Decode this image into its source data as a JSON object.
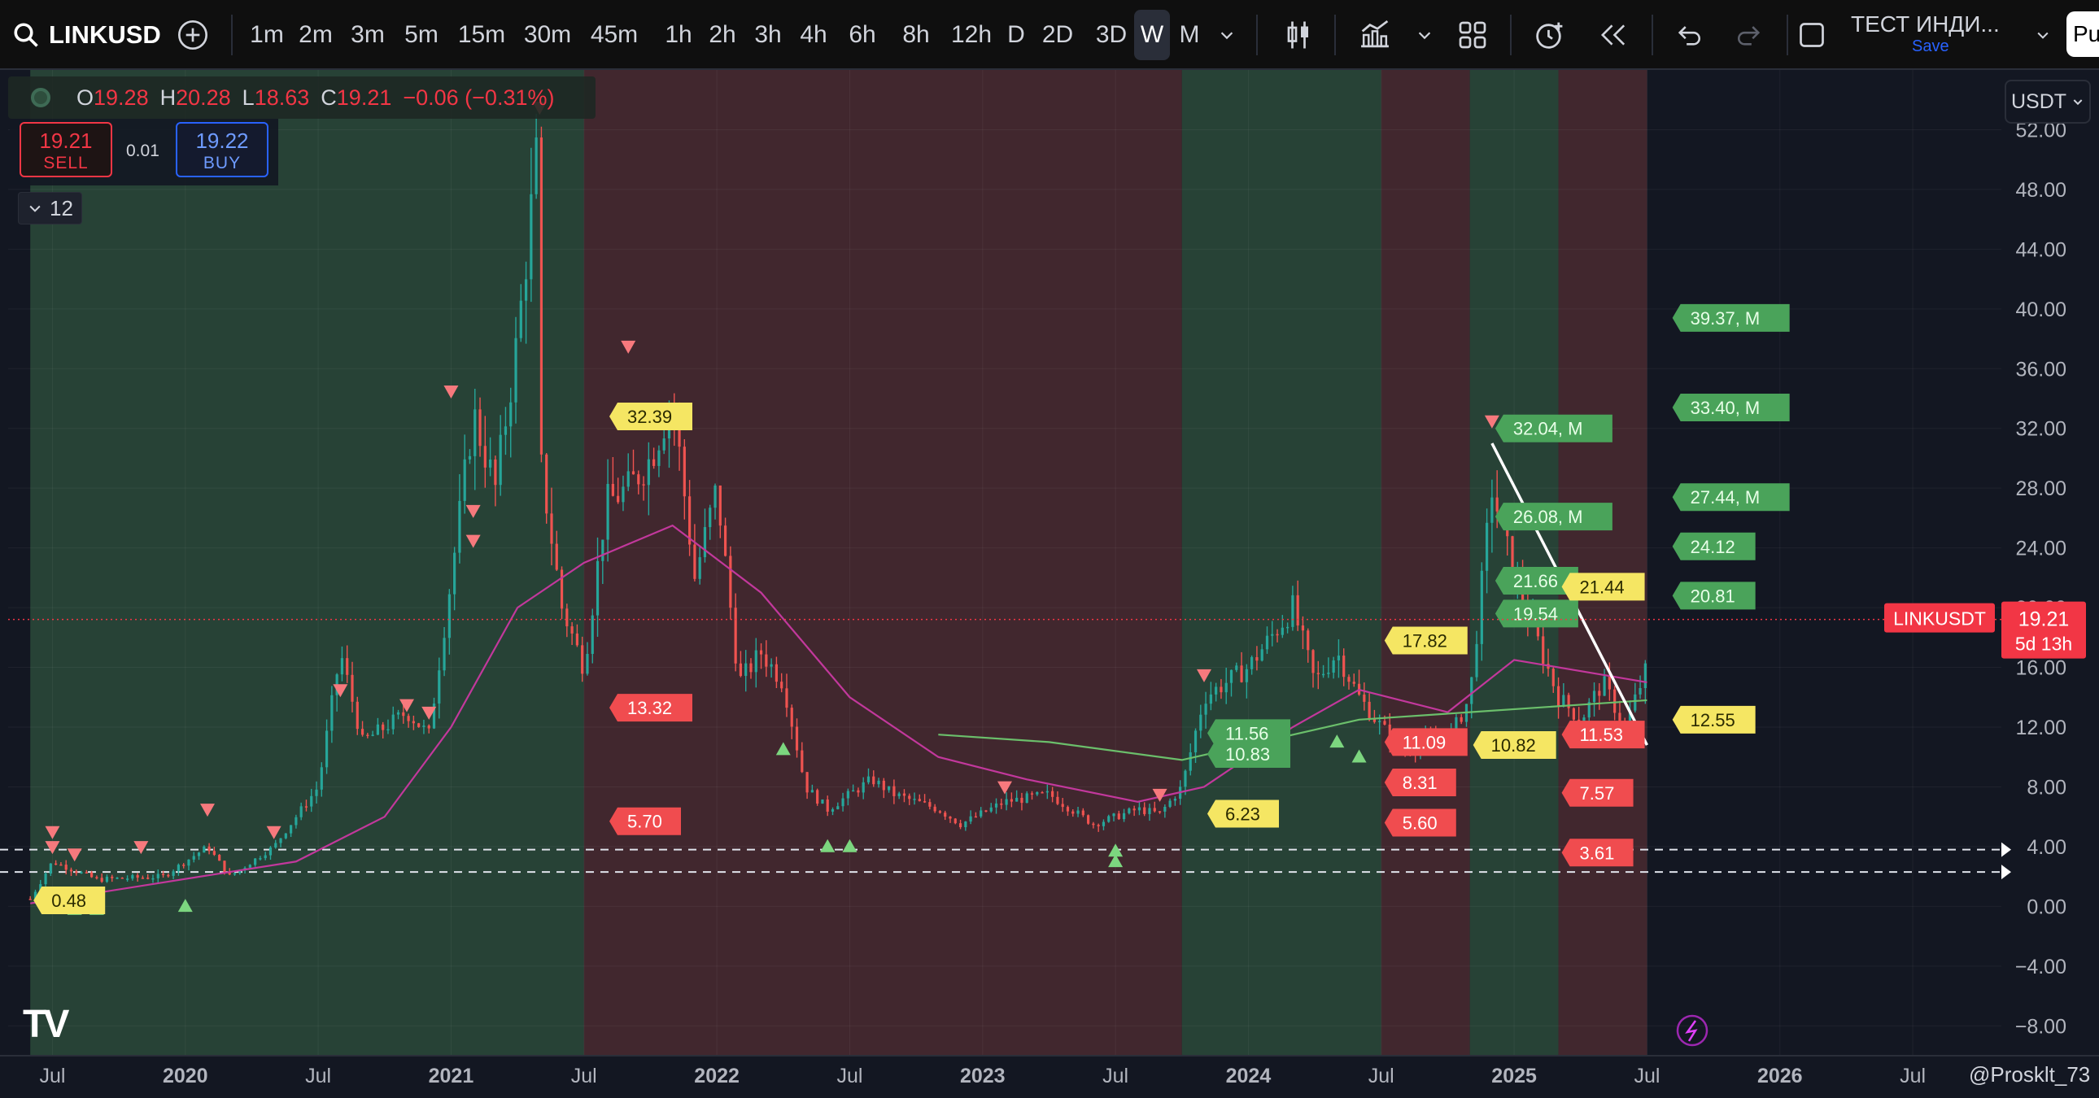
{
  "toolbar": {
    "symbol": "LINKUSD",
    "intervals": [
      "1m",
      "2m",
      "3m",
      "5m",
      "15m",
      "30m",
      "45m",
      "1h",
      "2h",
      "3h",
      "4h",
      "6h",
      "8h",
      "12h",
      "D",
      "2D",
      "3D",
      "W",
      "M"
    ],
    "active_interval": "W",
    "indicator_name": "ТЕСТ ИНДИ...",
    "save_label": "Save",
    "publish_label": "Pu"
  },
  "legend": {
    "o_label": "O",
    "o": "19.28",
    "h_label": "H",
    "h": "20.28",
    "l_label": "L",
    "l": "18.63",
    "c_label": "C",
    "c": "19.21",
    "change": "−0.06 (−0.31%)"
  },
  "trade": {
    "sell_price": "19.21",
    "sell_label": "SELL",
    "spread": "0.01",
    "buy_price": "19.22",
    "buy_label": "BUY"
  },
  "indicators_count": "12",
  "currency": "USDT",
  "price_axis": {
    "labels": [
      "52.00",
      "48.00",
      "44.00",
      "40.00",
      "36.00",
      "32.00",
      "28.00",
      "24.00",
      "20.00",
      "16.00",
      "12.00",
      "8.00",
      "4.00",
      "0.00",
      "−4.00",
      "−8.00"
    ]
  },
  "time_axis": {
    "labels": [
      {
        "text": "Jul",
        "bold": false
      },
      {
        "text": "2020",
        "bold": true
      },
      {
        "text": "Jul",
        "bold": false
      },
      {
        "text": "2021",
        "bold": true
      },
      {
        "text": "Jul",
        "bold": false
      },
      {
        "text": "2022",
        "bold": true
      },
      {
        "text": "Jul",
        "bold": false
      },
      {
        "text": "2023",
        "bold": true
      },
      {
        "text": "Jul",
        "bold": false
      },
      {
        "text": "2024",
        "bold": true
      },
      {
        "text": "Jul",
        "bold": false
      },
      {
        "text": "2025",
        "bold": true
      },
      {
        "text": "Jul",
        "bold": false
      },
      {
        "text": "2026",
        "bold": true
      },
      {
        "text": "Jul",
        "bold": false
      }
    ]
  },
  "chart_data": {
    "type": "candlestick",
    "symbol": "LINKUSDT",
    "interval": "W",
    "ylim": [
      -10,
      56
    ],
    "last_price": "19.21",
    "countdown": "5d 13h",
    "bands": [
      {
        "from": "2019-06",
        "to": "2021-07",
        "color": "#2c4a3a"
      },
      {
        "from": "2021-07",
        "to": "2023-10",
        "color": "#4a2a30"
      },
      {
        "from": "2023-10",
        "to": "2024-07",
        "color": "#2c4a3a"
      },
      {
        "from": "2024-07",
        "to": "2024-11",
        "color": "#4a2a30"
      },
      {
        "from": "2024-11",
        "to": "2025-03",
        "color": "#2c4a3a"
      },
      {
        "from": "2025-03",
        "to": "2025-07",
        "color": "#4a2a30"
      }
    ],
    "price_path": [
      [
        "2019-06",
        0.5
      ],
      [
        "2019-07",
        3.0
      ],
      [
        "2019-09",
        1.8
      ],
      [
        "2019-12",
        2.0
      ],
      [
        "2020-02",
        4.0
      ],
      [
        "2020-03",
        2.0
      ],
      [
        "2020-05",
        4.0
      ],
      [
        "2020-07",
        8.0
      ],
      [
        "2020-08",
        17.0
      ],
      [
        "2020-09",
        11.0
      ],
      [
        "2020-11",
        13.0
      ],
      [
        "2020-12",
        11.5
      ],
      [
        "2021-01",
        22.0
      ],
      [
        "2021-02",
        33.0
      ],
      [
        "2021-03",
        28.0
      ],
      [
        "2021-04",
        38.0
      ],
      [
        "2021-05",
        52.0
      ],
      [
        "2021-05",
        30.0
      ],
      [
        "2021-06",
        20.0
      ],
      [
        "2021-07",
        16.0
      ],
      [
        "2021-08",
        27.0
      ],
      [
        "2021-09",
        28.0
      ],
      [
        "2021-10",
        30.0
      ],
      [
        "2021-11",
        34.0
      ],
      [
        "2021-12",
        22.0
      ],
      [
        "2022-01",
        28.0
      ],
      [
        "2022-02",
        15.0
      ],
      [
        "2022-03",
        17.0
      ],
      [
        "2022-04",
        15.0
      ],
      [
        "2022-05",
        8.0
      ],
      [
        "2022-06",
        6.5
      ],
      [
        "2022-08",
        8.5
      ],
      [
        "2022-09",
        7.5
      ],
      [
        "2022-11",
        6.5
      ],
      [
        "2022-12",
        5.5
      ],
      [
        "2023-02",
        7.0
      ],
      [
        "2023-04",
        7.5
      ],
      [
        "2023-06",
        5.5
      ],
      [
        "2023-08",
        6.5
      ],
      [
        "2023-09",
        6.2
      ],
      [
        "2023-10",
        8.0
      ],
      [
        "2023-11",
        14.0
      ],
      [
        "2023-12",
        15.0
      ],
      [
        "2024-01",
        16.0
      ],
      [
        "2024-03",
        20.0
      ],
      [
        "2024-04",
        15.0
      ],
      [
        "2024-05",
        17.0
      ],
      [
        "2024-06",
        14.0
      ],
      [
        "2024-07",
        12.0
      ],
      [
        "2024-08",
        10.5
      ],
      [
        "2024-09",
        11.0
      ],
      [
        "2024-10",
        11.0
      ],
      [
        "2024-11",
        14.0
      ],
      [
        "2024-12",
        28.0
      ],
      [
        "2025-01",
        22.0
      ],
      [
        "2025-02",
        18.0
      ],
      [
        "2025-03",
        14.0
      ],
      [
        "2025-04",
        12.5
      ],
      [
        "2025-05",
        15.0
      ],
      [
        "2025-06",
        12.0
      ],
      [
        "2025-07",
        16.0
      ],
      [
        "2025-07",
        19.21
      ]
    ],
    "ma_magenta": [
      [
        "2019-06",
        0.2
      ],
      [
        "2020-06",
        3.0
      ],
      [
        "2020-10",
        6.0
      ],
      [
        "2021-01",
        12.0
      ],
      [
        "2021-04",
        20.0
      ],
      [
        "2021-07",
        23.0
      ],
      [
        "2021-11",
        25.5
      ],
      [
        "2022-03",
        21.0
      ],
      [
        "2022-07",
        14.0
      ],
      [
        "2022-11",
        10.0
      ],
      [
        "2023-03",
        8.5
      ],
      [
        "2023-08",
        7.0
      ],
      [
        "2023-11",
        8.0
      ],
      [
        "2024-03",
        12.0
      ],
      [
        "2024-06",
        14.5
      ],
      [
        "2024-10",
        13.0
      ],
      [
        "2025-01",
        16.5
      ],
      [
        "2025-05",
        15.5
      ],
      [
        "2025-07",
        15.0
      ]
    ],
    "ma_green": [
      [
        "2022-11",
        11.5
      ],
      [
        "2023-04",
        11.0
      ],
      [
        "2023-10",
        9.8
      ],
      [
        "2024-06",
        12.5
      ],
      [
        "2024-11",
        13.0
      ],
      [
        "2025-04",
        13.5
      ],
      [
        "2025-07",
        13.8
      ]
    ],
    "trendline": [
      [
        "2024-12",
        31.0
      ],
      [
        "2025-07",
        10.8
      ]
    ],
    "dashed_levels": [
      3.8,
      2.3
    ],
    "labels": [
      {
        "text": "32.39",
        "date": "2021-08",
        "price": 32.8,
        "color": "yellow"
      },
      {
        "text": "13.32",
        "date": "2021-08",
        "price": 13.3,
        "color": "red"
      },
      {
        "text": "5.70",
        "date": "2021-08",
        "price": 5.7,
        "color": "red"
      },
      {
        "text": "0.48",
        "date": "2019-06",
        "price": 0.4,
        "color": "yellow"
      },
      {
        "text": "11.56",
        "date": "2023-11",
        "price": 11.6,
        "color": "green"
      },
      {
        "text": "10.83",
        "date": "2023-11",
        "price": 10.2,
        "color": "green"
      },
      {
        "text": "6.23",
        "date": "2023-11",
        "price": 6.2,
        "color": "yellow"
      },
      {
        "text": "17.82",
        "date": "2024-07",
        "price": 17.8,
        "color": "yellow"
      },
      {
        "text": "11.09",
        "date": "2024-07",
        "price": 11.0,
        "color": "red"
      },
      {
        "text": "8.31",
        "date": "2024-07",
        "price": 8.3,
        "color": "red"
      },
      {
        "text": "5.60",
        "date": "2024-07",
        "price": 5.6,
        "color": "red"
      },
      {
        "text": "32.04, M",
        "date": "2024-12",
        "price": 32.0,
        "color": "green"
      },
      {
        "text": "26.08, M",
        "date": "2024-12",
        "price": 26.1,
        "color": "green"
      },
      {
        "text": "21.66",
        "date": "2024-12",
        "price": 21.8,
        "color": "green"
      },
      {
        "text": "19.54",
        "date": "2024-12",
        "price": 19.6,
        "color": "green"
      },
      {
        "text": "10.82",
        "date": "2024-11",
        "price": 10.8,
        "color": "yellow"
      },
      {
        "text": "21.44",
        "date": "2025-03",
        "price": 21.4,
        "color": "yellow"
      },
      {
        "text": "11.53",
        "date": "2025-03",
        "price": 11.5,
        "color": "red"
      },
      {
        "text": "7.57",
        "date": "2025-03",
        "price": 7.6,
        "color": "red"
      },
      {
        "text": "3.61",
        "date": "2025-03",
        "price": 3.6,
        "color": "red"
      },
      {
        "text": "39.37, M",
        "date": "2025-08",
        "price": 39.4,
        "color": "green"
      },
      {
        "text": "33.40, M",
        "date": "2025-08",
        "price": 33.4,
        "color": "green"
      },
      {
        "text": "27.44, M",
        "date": "2025-08",
        "price": 27.4,
        "color": "green"
      },
      {
        "text": "24.12",
        "date": "2025-08",
        "price": 24.1,
        "color": "green"
      },
      {
        "text": "20.81",
        "date": "2025-08",
        "price": 20.8,
        "color": "green"
      },
      {
        "text": "12.55",
        "date": "2025-08",
        "price": 12.5,
        "color": "yellow"
      }
    ],
    "sell_signals": [
      [
        "2019-07",
        4.5
      ],
      [
        "2019-07",
        3.5
      ],
      [
        "2019-08",
        3.0
      ],
      [
        "2019-11",
        3.5
      ],
      [
        "2020-02",
        6.0
      ],
      [
        "2020-05",
        4.5
      ],
      [
        "2020-08",
        14.0
      ],
      [
        "2020-11",
        13.0
      ],
      [
        "2020-12",
        12.5
      ],
      [
        "2021-01",
        34.0
      ],
      [
        "2021-02",
        26.0
      ],
      [
        "2021-02",
        24.0
      ],
      [
        "2021-05",
        53.0
      ],
      [
        "2021-09",
        37.0
      ],
      [
        "2023-02",
        7.5
      ],
      [
        "2023-09",
        7.0
      ],
      [
        "2023-11",
        15.0
      ],
      [
        "2024-12",
        32.0
      ]
    ],
    "buy_signals": [
      [
        "2019-08",
        0.3
      ],
      [
        "2019-09",
        0.3
      ],
      [
        "2020-01",
        0.5
      ],
      [
        "2022-04",
        11.0
      ],
      [
        "2022-06",
        4.5
      ],
      [
        "2022-07",
        4.5
      ],
      [
        "2023-07",
        3.5
      ],
      [
        "2023-07",
        4.2
      ],
      [
        "2024-05",
        11.5
      ],
      [
        "2024-06",
        10.5
      ],
      [
        "2025-04",
        11.5
      ]
    ]
  },
  "watermark_author": "@Prosklt_73"
}
